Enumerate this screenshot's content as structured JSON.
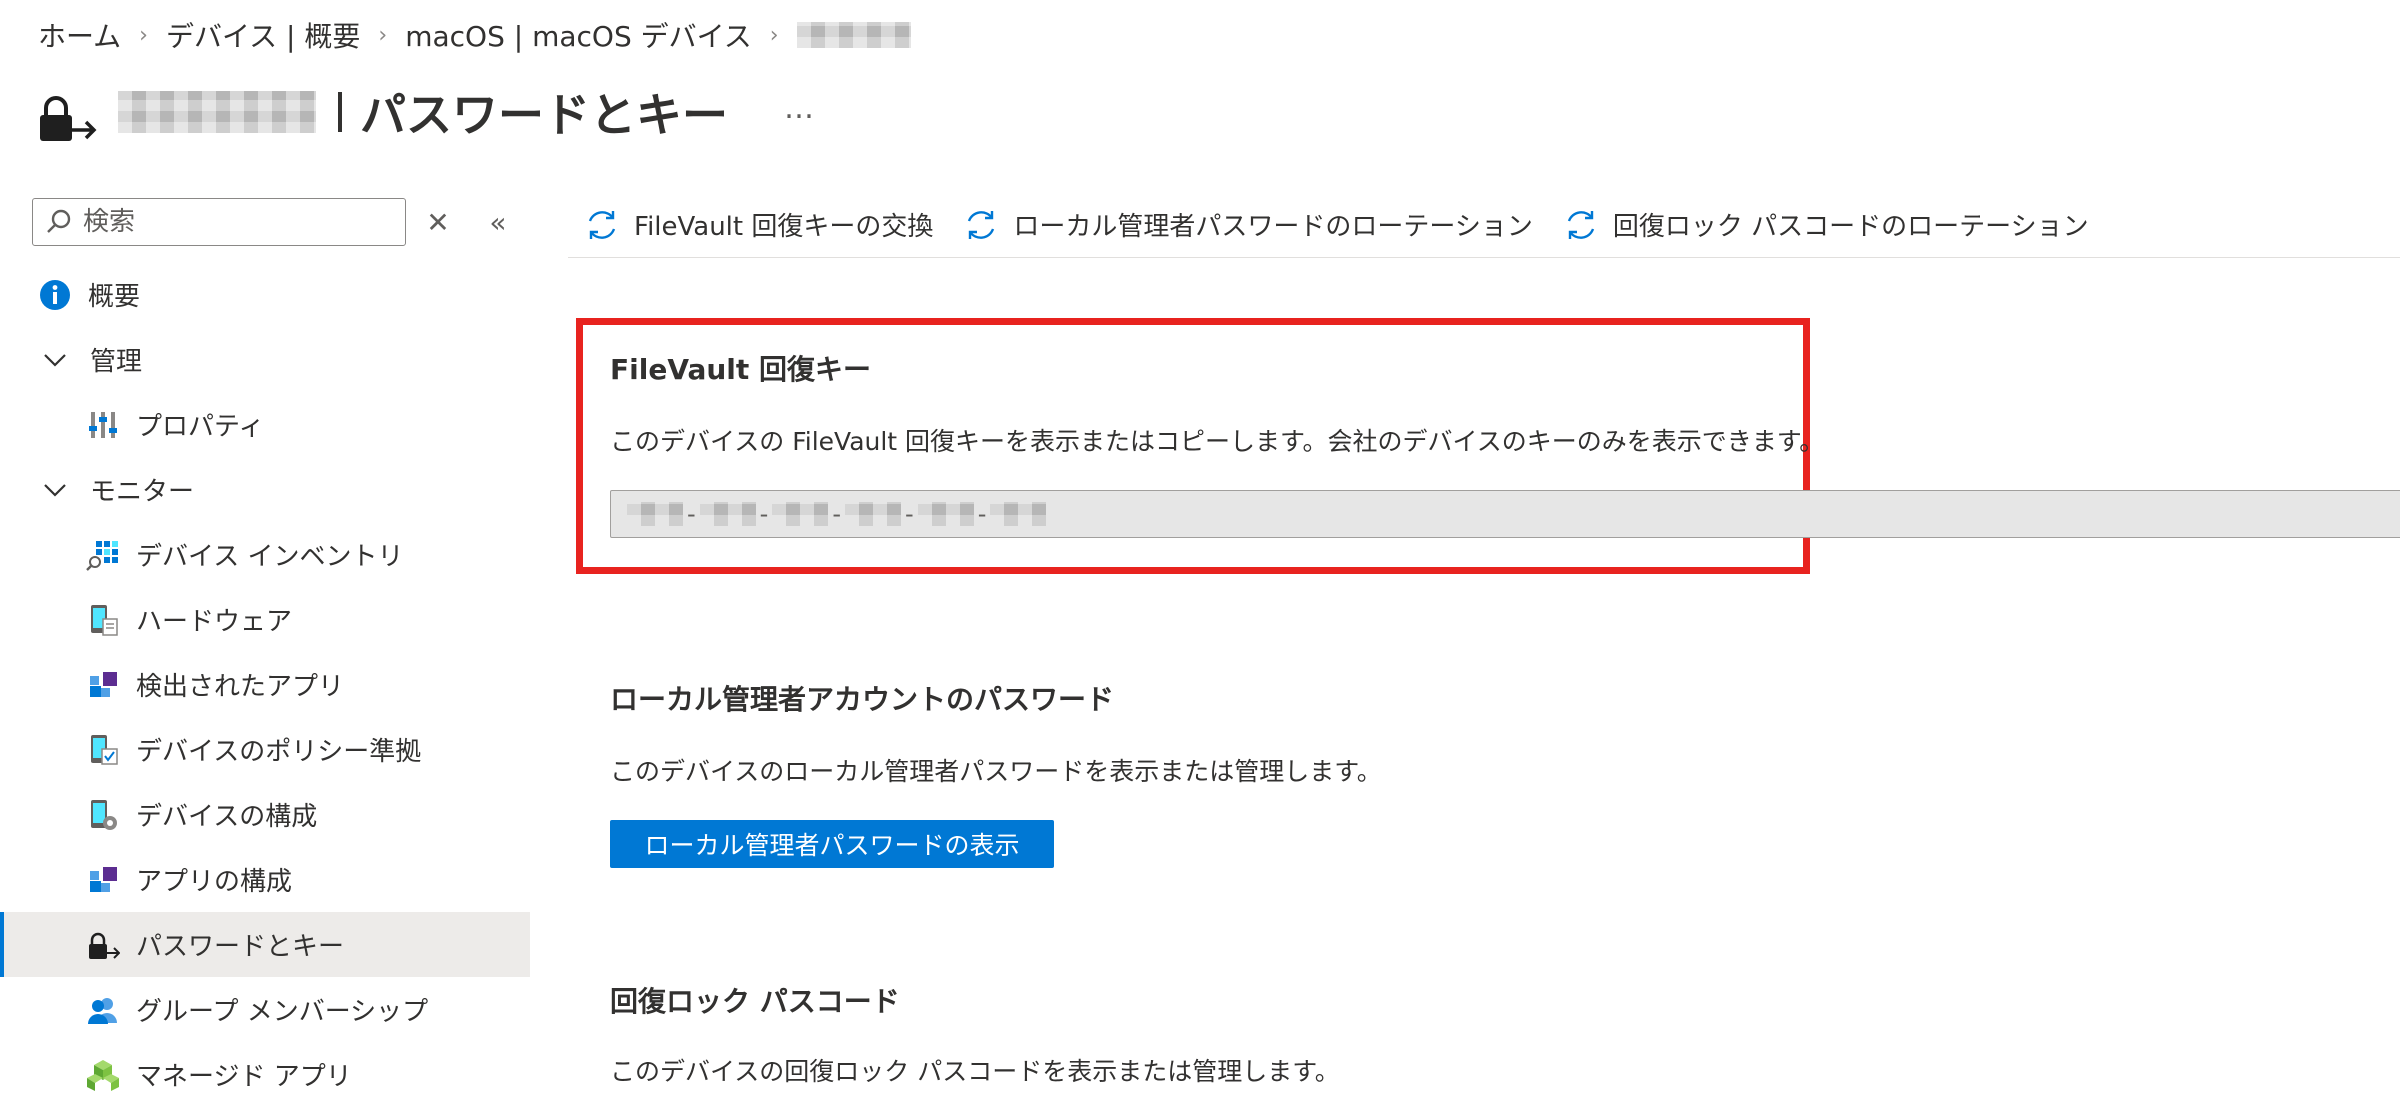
{
  "breadcrumb": {
    "items": [
      "ホーム",
      "デバイス | 概要",
      "macOS | macOS デバイス"
    ],
    "separator": "›"
  },
  "header": {
    "title": "パスワードとキー",
    "more": "…"
  },
  "sidebar": {
    "search_placeholder": "検索",
    "clear": "✕",
    "collapse": "«",
    "items": [
      {
        "label": "概要",
        "icon": "info-icon"
      },
      {
        "label": "管理",
        "icon": "chevron-down-icon",
        "group": true
      },
      {
        "label": "プロパティ",
        "icon": "properties-icon"
      },
      {
        "label": "モニター",
        "icon": "chevron-down-icon",
        "group": true
      },
      {
        "label": "デバイス インベントリ",
        "icon": "inventory-icon"
      },
      {
        "label": "ハードウェア",
        "icon": "hardware-icon"
      },
      {
        "label": "検出されたアプリ",
        "icon": "apps-icon"
      },
      {
        "label": "デバイスのポリシー準拠",
        "icon": "compliance-icon"
      },
      {
        "label": "デバイスの構成",
        "icon": "device-config-icon"
      },
      {
        "label": "アプリの構成",
        "icon": "app-config-icon"
      },
      {
        "label": "パスワードとキー",
        "icon": "lock-arrow-icon",
        "selected": true
      },
      {
        "label": "グループ メンバーシップ",
        "icon": "group-icon"
      },
      {
        "label": "マネージド アプリ",
        "icon": "managed-apps-icon"
      }
    ]
  },
  "toolbar": {
    "buttons": [
      {
        "label": "FileVault 回復キーの交換",
        "icon": "refresh-icon"
      },
      {
        "label": "ローカル管理者パスワードのローテーション",
        "icon": "refresh-icon"
      },
      {
        "label": "回復ロック パスコードのローテーション",
        "icon": "refresh-icon"
      }
    ]
  },
  "sections": {
    "filevault": {
      "title": "FileVault 回復キー",
      "description": "このデバイスの FileVault 回復キーを表示またはコピーします。会社のデバイスのキーのみを表示できます。"
    },
    "local_admin": {
      "title": "ローカル管理者アカウントのパスワード",
      "description": "このデバイスのローカル管理者パスワードを表示または管理します。",
      "button": "ローカル管理者パスワードの表示"
    },
    "recovery_lock": {
      "title": "回復ロック パスコード",
      "description": "このデバイスの回復ロック パスコードを表示または管理します。"
    }
  },
  "colors": {
    "accent": "#0078d4",
    "highlight": "#e8231f",
    "selected_bg": "#edebe9"
  }
}
